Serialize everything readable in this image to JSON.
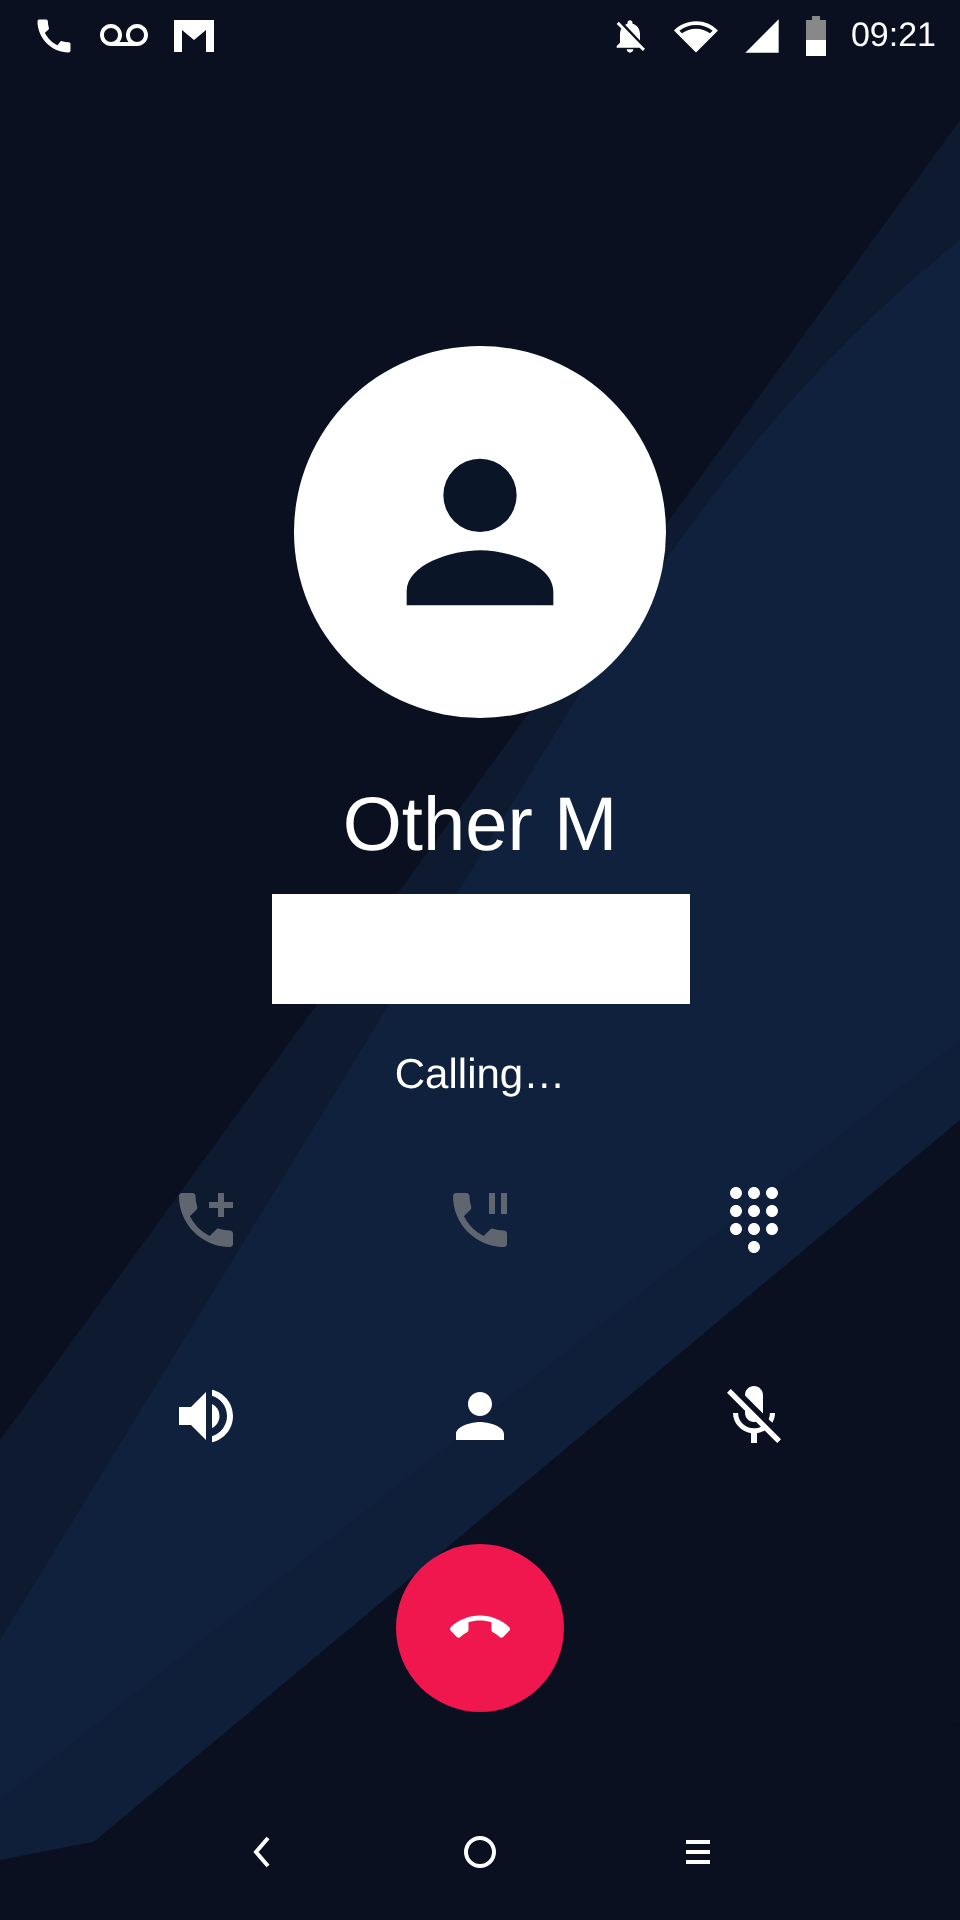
{
  "status_bar": {
    "time": "09:21"
  },
  "caller": {
    "name": "Other M",
    "number_redacted": true,
    "status": "Calling…"
  },
  "controls": [
    {
      "kind": "add_call",
      "disabled": true
    },
    {
      "kind": "hold",
      "disabled": true
    },
    {
      "kind": "dialpad",
      "disabled": false
    },
    {
      "kind": "speaker",
      "disabled": false
    },
    {
      "kind": "contacts",
      "disabled": false
    },
    {
      "kind": "mute",
      "disabled": false
    }
  ]
}
